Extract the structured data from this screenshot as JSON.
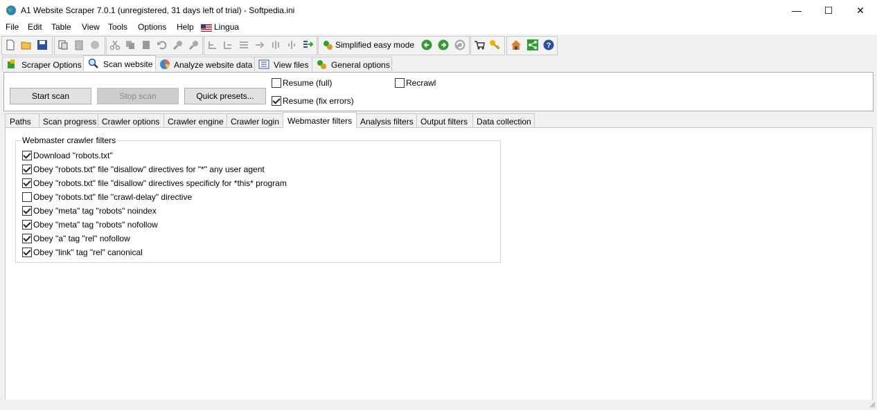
{
  "window": {
    "title": "A1 Website Scraper 7.0.1 (unregistered, 31 days left of trial) - Softpedia.ini",
    "minimize": "—",
    "maximize": "☐",
    "close": "✕"
  },
  "menu": [
    "File",
    "Edit",
    "Table",
    "View",
    "Tools",
    "Options",
    "Help",
    "Lingua"
  ],
  "toolbar": {
    "simplified_label": "Simplified easy mode"
  },
  "main_tabs": [
    "Scraper Options",
    "Scan website",
    "Analyze website data",
    "View files",
    "General options"
  ],
  "scan": {
    "start": "Start scan",
    "stop": "Stop scan",
    "presets": "Quick presets...",
    "resume_full": "Resume (full)",
    "resume_fix": "Resume (fix errors)",
    "recrawl": "Recrawl"
  },
  "sub_tabs": [
    "Paths",
    "Scan progress",
    "Crawler options",
    "Crawler engine",
    "Crawler login",
    "Webmaster filters",
    "Analysis filters",
    "Output filters",
    "Data collection"
  ],
  "filters": {
    "legend": "Webmaster crawler filters",
    "items": [
      {
        "label": "Download \"robots.txt\"",
        "checked": true
      },
      {
        "label": "Obey \"robots.txt\" file \"disallow\" directives for \"*\" any user agent",
        "checked": true
      },
      {
        "label": "Obey \"robots.txt\" file \"disallow\" directives specificly for *this* program",
        "checked": true
      },
      {
        "label": "Obey \"robots.txt\" file \"crawl-delay\" directive",
        "checked": false
      },
      {
        "label": "Obey \"meta\" tag \"robots\" noindex",
        "checked": true
      },
      {
        "label": "Obey \"meta\" tag \"robots\" nofollow",
        "checked": true
      },
      {
        "label": "Obey \"a\" tag \"rel\" nofollow",
        "checked": true
      },
      {
        "label": "Obey \"link\" tag \"rel\" canonical",
        "checked": true
      }
    ]
  },
  "colors": {
    "accent": "#0078d7",
    "green": "#2e9e2e",
    "red": "#c0392b"
  }
}
